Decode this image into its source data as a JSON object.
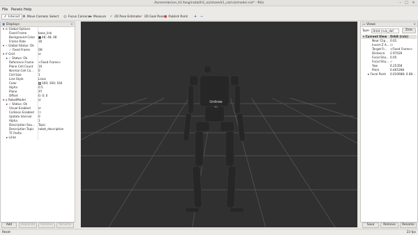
{
  "window": {
    "title": "/home/mbs/ars_h1-fang/install/h1_viz/share/h1_viz/rviz/model.rviz* - RViz"
  },
  "menubar": {
    "items": [
      "File",
      "Panels",
      "Help"
    ]
  },
  "toolbar": {
    "interact": "Interact",
    "move_camera": "Move Camera",
    "select": "Select",
    "focus_camera": "Focus Camera",
    "measure": "Measure",
    "pose_estimate": "2D Pose Estimate",
    "goal_pose": "2D Goal Pose",
    "publish_point": "Publish Point"
  },
  "displays": {
    "title": "Displays",
    "global_options": "Global Options",
    "fixed_frame_label": "Fixed Frame",
    "fixed_frame_value": "base_link",
    "background_color_label": "Background Color",
    "background_color_value": "48; 48; 48",
    "frame_rate_label": "Frame Rate",
    "frame_rate_value": "30",
    "global_status_label": "Global Status: Ok",
    "gs_fixed_frame_label": "Fixed Frame",
    "gs_fixed_frame_value": "OK",
    "grid_label": "Grid",
    "grid_status_label": "Status: Ok",
    "reference_frame_label": "Reference Frame",
    "reference_frame_value": "<Fixed Frame>",
    "plane_cell_count_label": "Plane Cell Count",
    "plane_cell_count_value": "10",
    "normal_cell_count_label": "Normal Cell Co...",
    "normal_cell_count_value": "0",
    "cell_size_label": "Cell Size",
    "cell_size_value": "1",
    "line_style_label": "Line Style",
    "line_style_value": "Lines",
    "color_label": "Color",
    "color_value": "160; 160; 164",
    "alpha_label": "Alpha",
    "alpha_value": "0.5",
    "plane_label": "Plane",
    "plane_value": "XY",
    "offset_label": "Offset",
    "offset_value": "0; 0; 0",
    "robotmodel_label": "RobotModel",
    "rm_status_label": "Status: Ok",
    "visual_enabled_label": "Visual Enabled",
    "collision_enabled_label": "Collision Enabled",
    "update_interval_label": "Update Interval",
    "update_interval_value": "0",
    "rm_alpha_label": "Alpha",
    "rm_alpha_value": "1",
    "description_source_label": "Description Sou...",
    "description_source_value": "Topic",
    "description_topic_label": "Description Topic",
    "description_topic_value": "robot_description",
    "tf_prefix_label": "TF Prefix",
    "links_label": "Links",
    "add_button": "Add",
    "duplicate_button": "Duplicate",
    "remove_button": "Remove",
    "rename_button": "Rename"
  },
  "viewport": {
    "robot_label": "Unitree",
    "robot_sub": "H1"
  },
  "views": {
    "title": "Views",
    "type_label": "Type:",
    "type_value": "Orbit (rviz_def",
    "zero_button": "Zero",
    "current_view_label": "Current View",
    "current_view_value": "Orbit (rviz)",
    "near_clip_label": "Near Clip...",
    "near_clip_value": "0.01",
    "invert_z_label": "Invert Z A...",
    "target_frame_label": "Target Fr...",
    "target_frame_value": "<Fixed Frame>",
    "distance_label": "Distance",
    "distance_value": "2.97026",
    "focal_shape1_label": "Focal Sha...",
    "focal_shape1_value": "0.05",
    "focal_shape2_label": "Focal Sha...",
    "focal_shape2_value": "✓",
    "yaw_label": "Yaw",
    "yaw_value": "6.25358",
    "pitch_label": "Pitch",
    "pitch_value": "0.465398",
    "focal_point_label": "Focal Point",
    "focal_point_value": "0.010688; 0.08...",
    "save_button": "Save",
    "remove_button": "Remove",
    "rename_button": "Rename"
  },
  "status": {
    "reset_button": "Reset",
    "fps": "23 fps"
  }
}
